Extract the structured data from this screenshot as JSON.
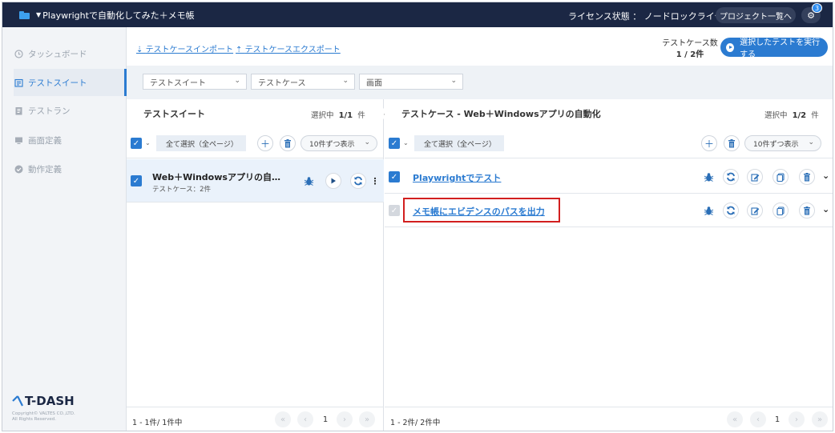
{
  "topbar": {
    "project_name": "Playwrightで自動化してみた＋メモ帳",
    "license_label": "ライセンス状態 ： ノードロックライセンス",
    "projects_button": "プロジェクト一覧へ",
    "notification_count": "3"
  },
  "sidebar": {
    "items": [
      {
        "label": "タッシュボード",
        "icon": "clock-icon",
        "active": false
      },
      {
        "label": "テストスイート",
        "icon": "suite-icon",
        "active": true
      },
      {
        "label": "テストラン",
        "icon": "run-icon",
        "active": false
      },
      {
        "label": "画面定義",
        "icon": "monitor-icon",
        "active": false
      },
      {
        "label": "動作定義",
        "icon": "check-circle-icon",
        "active": false
      }
    ],
    "logo_text": "T-DASH",
    "copyright_line1": "Copyright© VALTES CO.,LTD.",
    "copyright_line2": "All Rights Reserved."
  },
  "header": {
    "import_link": "テストケースインポート",
    "export_link": "テストケースエクスポート",
    "count_label": "テストケース数",
    "count_value": "1 / 2件",
    "run_button": "選択したテストを実行する"
  },
  "filters": {
    "suite_placeholder": "テストスイート",
    "case_placeholder": "テストケース",
    "screen_placeholder": "画面"
  },
  "left_panel": {
    "title": "テストスイート",
    "selection_label": "選択中",
    "selection_value": "1/1",
    "selection_unit": "件",
    "select_all": "全て選択（全ページ）",
    "per_page": "10件ずつ表示",
    "suite": {
      "name": "Web＋Windowsアプリの自動…",
      "sub": "テストケース：2件"
    },
    "footer_range": "1 - 1件/ 1件中",
    "page": "1"
  },
  "right_panel": {
    "title": "テストケース - Web＋Windowsアプリの自動化",
    "selection_label": "選択中",
    "selection_value": "1/2",
    "selection_unit": "件",
    "select_all": "全て選択（全ページ）",
    "per_page": "10件ずつ表示",
    "cases": [
      {
        "name": "Playwrightでテスト",
        "checked": true
      },
      {
        "name": "メモ帳にエビデンスのパスを出力",
        "checked": false
      }
    ],
    "footer_range": "1 - 2件/ 2件中",
    "page": "1"
  },
  "colors": {
    "topbar": "#1b2744",
    "accent": "#2b7bd1",
    "highlight": "#d21f1f"
  }
}
